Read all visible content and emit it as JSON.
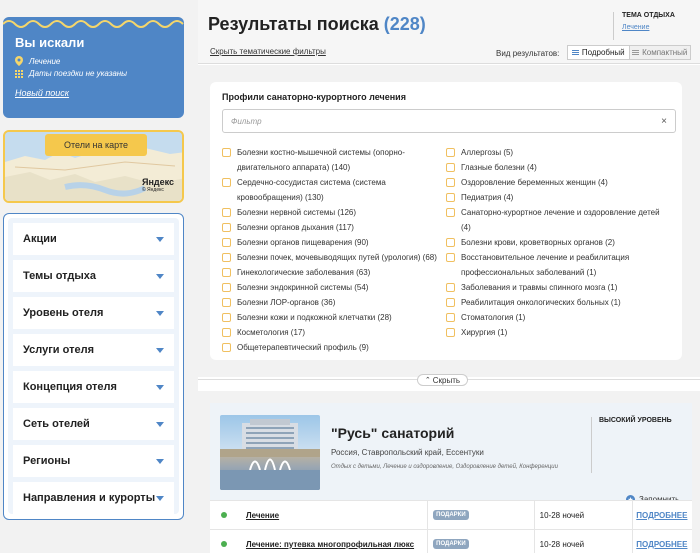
{
  "search": {
    "title": "Вы искали",
    "location": "Лечение",
    "dates": "Даты поездки не указаны",
    "new_search": "Новый поиск"
  },
  "map": {
    "button": "Отели на карте",
    "logo": "Яндекс",
    "logo_sub": "© Яндекс"
  },
  "filters": [
    {
      "label": "Акции"
    },
    {
      "label": "Темы отдыха"
    },
    {
      "label": "Уровень отеля"
    },
    {
      "label": "Услуги отеля"
    },
    {
      "label": "Концепция отеля"
    },
    {
      "label": "Сеть отелей"
    },
    {
      "label": "Регионы"
    },
    {
      "label": "Направления и курорты"
    }
  ],
  "header": {
    "title": "Результаты поиска",
    "count": "(228)",
    "hide_filters": "Скрыть тематические фильтры",
    "topic_title": "ТЕМА ОТДЫХА",
    "topic_value": "Лечение",
    "view_label": "Вид результатов:",
    "view_detailed": "Подробный",
    "view_compact": "Компактный"
  },
  "profiles": {
    "title": "Профили санаторно-курортного лечения",
    "placeholder": "Фильтр",
    "clear": "×",
    "left": [
      "Болезни костно-мышечной системы (опорно-двигательного аппарата) (140)",
      "Сердечно-сосудистая система (система кровообращения) (130)",
      "Болезни нервной системы (126)",
      "Болезни органов дыхания (117)",
      "Болезни органов пищеварения (90)",
      "Болезни почек, мочевыводящих путей (урология) (68)",
      "Гинекологические заболевания (63)",
      "Болезни эндокринной системы (54)",
      "Болезни ЛОР-органов (36)",
      "Болезни кожи и подкожной клетчатки (28)",
      "Косметология (17)",
      "Общетерапевтический профиль (9)"
    ],
    "right": [
      "Аллергозы (5)",
      "Глазные болезни (4)",
      "Оздоровление беременных женщин (4)",
      "Педиатрия (4)",
      "Санаторно-курортное лечение и оздоровление детей (4)",
      "Болезни крови, кроветворных органов (2)",
      "Восстановительное лечение и реабилитация профессиональных заболеваний (1)",
      "Заболевания и травмы спинного мозга (1)",
      "Реабилитация онкологических больных (1)",
      "Стоматология (1)",
      "Хирургия (1)"
    ],
    "collapse": "Скрыть"
  },
  "hotel": {
    "name": "\"Русь\" санаторий",
    "location": "Россия, Ставропольский край, Ессентуки",
    "tags": "Отдых с детьми, Лечение и оздоровление, Оздоровление детей, Конференции",
    "level": "ВЫСОКИЙ УРОВЕНЬ",
    "remember": "Запомнить",
    "offers": [
      {
        "name": "Лечение",
        "badge": "ПОДАРКИ",
        "nights": "10-28 ночей",
        "more": "ПОДРОБНЕЕ"
      },
      {
        "name": "Лечение: путевка многопрофильная люкс",
        "badge": "ПОДАРКИ",
        "nights": "10-28 ночей",
        "more": "ПОДРОБНЕЕ"
      }
    ]
  }
}
